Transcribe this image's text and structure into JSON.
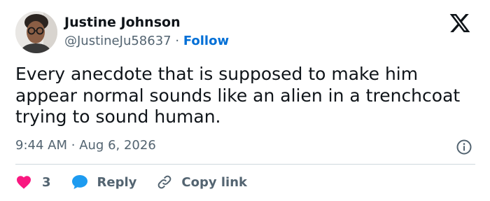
{
  "author": {
    "name": "Justine Johnson",
    "handle": "@JustineJu58637",
    "separator": "·",
    "follow_label": "Follow"
  },
  "tweet": {
    "text": "Every anecdote that is supposed to make him appear normal sounds like an alien in a trenchcoat trying to sound human.",
    "time": "9:44 AM",
    "time_separator": "·",
    "date": "Aug 6, 2026"
  },
  "actions": {
    "like_count": "3",
    "reply_label": "Reply",
    "copy_label": "Copy link"
  },
  "icons": {
    "logo": "x-logo-icon",
    "info": "info-icon",
    "like": "heart-icon",
    "reply": "speech-bubble-icon",
    "copy": "link-icon"
  },
  "colors": {
    "like": "#f91880",
    "reply": "#1d9bf0",
    "follow": "#006fd6",
    "secondary_text": "#536471",
    "divider": "#cfd9de"
  }
}
